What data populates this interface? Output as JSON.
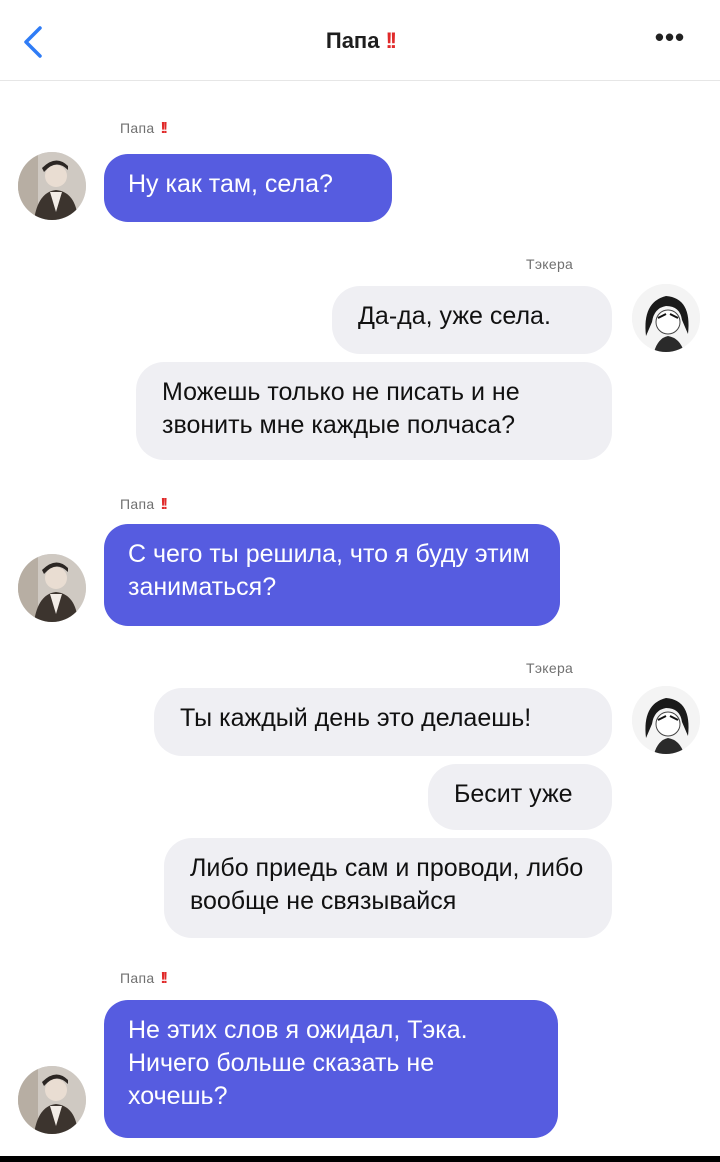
{
  "header": {
    "title": "Папа",
    "title_badge": "!!",
    "more_label": "•••"
  },
  "names": {
    "dad": "Папа",
    "dad_badge": "!!",
    "me": "Тэкера"
  },
  "messages": [
    {
      "from": "dad",
      "text": "Ну как там, села?"
    },
    {
      "from": "me",
      "text": "Да-да, уже села."
    },
    {
      "from": "me",
      "text": "Можешь только не писать и не звонить мне каждые полчаса?"
    },
    {
      "from": "dad",
      "text": "С чего ты решила, что я буду этим заниматься?"
    },
    {
      "from": "me",
      "text": "Ты каждый день это делаешь!"
    },
    {
      "from": "me",
      "text": "Бесит уже"
    },
    {
      "from": "me",
      "text": "Либо приедь сам и проводи, либо вообще не связывайся"
    },
    {
      "from": "dad",
      "text": "Не этих слов я ожидал, Тэка. Ничего больше сказать не хочешь?"
    }
  ],
  "colors": {
    "dad_bubble": "#565ce0",
    "my_bubble": "#efeff3",
    "accent_back": "#2f7cf6",
    "badge_red": "#e02a2a"
  }
}
